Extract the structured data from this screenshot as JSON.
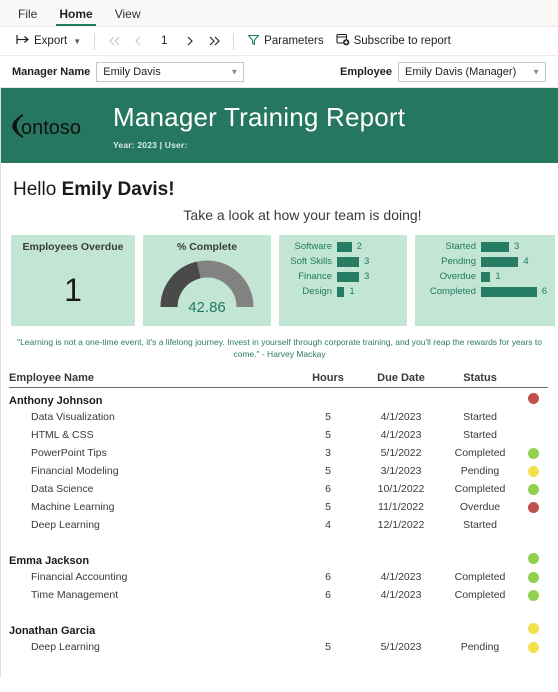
{
  "ribbon": {
    "tabs": [
      {
        "label": "File",
        "active": false
      },
      {
        "label": "Home",
        "active": true
      },
      {
        "label": "View",
        "active": false
      }
    ]
  },
  "toolbar": {
    "export_label": "Export",
    "export_icon": "export-icon",
    "first_page_icon": "first-page-icon",
    "prev_page_icon": "prev-page-icon",
    "page_number": "1",
    "next_page_icon": "next-page-icon",
    "last_page_icon": "last-page-icon",
    "parameters_label": "Parameters",
    "parameters_icon": "funnel-icon",
    "subscribe_label": "Subscribe to report",
    "subscribe_icon": "subscribe-icon"
  },
  "parameters": {
    "manager": {
      "label": "Manager Name",
      "value": "Emily Davis"
    },
    "employee": {
      "label": "Employee",
      "value": "Emily Davis (Manager)"
    }
  },
  "banner": {
    "logo_text": "ontoso",
    "title": "Manager Training Report",
    "subtitle": "Year: 2023 | User:",
    "bg_color": "#25785f"
  },
  "greeting": {
    "hello": "Hello ",
    "name": "Emily Davis!",
    "subtitle": "Take a look at how your team is doing!"
  },
  "cards": {
    "overdue": {
      "title": "Employees Overdue",
      "value": "1"
    },
    "complete": {
      "title": "% Complete",
      "value": "42.86",
      "percent": 42.86
    },
    "category": {
      "chart_ref": 0
    },
    "status": {
      "chart_ref": 1
    }
  },
  "chart_data": [
    {
      "type": "bar",
      "orientation": "horizontal",
      "title": "",
      "categories": [
        "Software",
        "Soft Skills",
        "Finance",
        "Design"
      ],
      "values": [
        2,
        3,
        3,
        1
      ],
      "xlabel": "",
      "ylabel": "",
      "xlim": [
        0,
        6
      ],
      "grid": false,
      "legend": "none",
      "bar_color": "#277d63",
      "data_labels": true
    },
    {
      "type": "bar",
      "orientation": "horizontal",
      "title": "",
      "categories": [
        "Started",
        "Pending",
        "Overdue",
        "Completed"
      ],
      "values": [
        3,
        4,
        1,
        6
      ],
      "xlabel": "",
      "ylabel": "",
      "xlim": [
        0,
        6
      ],
      "grid": false,
      "legend": "none",
      "bar_color": "#277d63",
      "data_labels": true
    },
    {
      "type": "gauge",
      "title": "% Complete",
      "value": 42.86,
      "min": 0,
      "max": 100,
      "fill_color": "#4a4a4a",
      "track_color": "#828282",
      "value_color": "#1f7a63"
    }
  ],
  "quote": "\"Learning is not a one-time event, it's a lifelong journey. Invest in yourself through corporate training, and you'll reap the rewards for years to come.\" - Harvey Mackay",
  "table": {
    "columns": [
      "Employee Name",
      "Hours",
      "Due Date",
      "Status"
    ],
    "groups": [
      {
        "name": "Anthony Johnson",
        "dot": "red",
        "rows": [
          {
            "name": "Data Visualization",
            "hours": "5",
            "due": "4/1/2023",
            "status": "Started",
            "dot": ""
          },
          {
            "name": "HTML & CSS",
            "hours": "5",
            "due": "4/1/2023",
            "status": "Started",
            "dot": ""
          },
          {
            "name": "PowerPoint Tips",
            "hours": "3",
            "due": "5/1/2022",
            "status": "Completed",
            "dot": "green"
          },
          {
            "name": "Financial Modeling",
            "hours": "5",
            "due": "3/1/2023",
            "status": "Pending",
            "dot": "amber"
          },
          {
            "name": "Data Science",
            "hours": "6",
            "due": "10/1/2022",
            "status": "Completed",
            "dot": "green"
          },
          {
            "name": "Machine Learning",
            "hours": "5",
            "due": "11/1/2022",
            "status": "Overdue",
            "dot": "red"
          },
          {
            "name": "Deep Learning",
            "hours": "4",
            "due": "12/1/2022",
            "status": "Started",
            "dot": ""
          }
        ]
      },
      {
        "name": "Emma Jackson",
        "dot": "green",
        "rows": [
          {
            "name": "Financial Accounting",
            "hours": "6",
            "due": "4/1/2023",
            "status": "Completed",
            "dot": "green"
          },
          {
            "name": "Time Management",
            "hours": "6",
            "due": "4/1/2023",
            "status": "Completed",
            "dot": "green"
          }
        ]
      },
      {
        "name": "Jonathan Garcia",
        "dot": "amber",
        "rows": [
          {
            "name": "Deep Learning",
            "hours": "5",
            "due": "5/1/2023",
            "status": "Pending",
            "dot": "amber"
          }
        ]
      }
    ]
  },
  "colors": {
    "brand_green": "#25785f",
    "card_bg": "#c3e6d4",
    "bar_green": "#277d63",
    "status_red": "#c0504d",
    "status_green": "#92d050",
    "status_amber": "#f2e14c"
  }
}
